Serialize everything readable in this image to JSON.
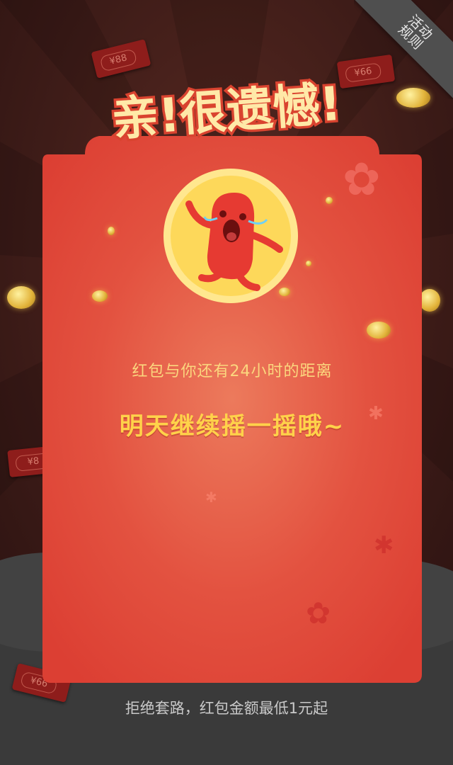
{
  "corner": {
    "rules_label": "活动规则"
  },
  "headline": {
    "text": "亲!很遗憾!"
  },
  "envelopes": [
    {
      "amount": "¥88"
    },
    {
      "amount": "¥66"
    },
    {
      "amount": "¥8"
    },
    {
      "amount": "¥66"
    }
  ],
  "card": {
    "subtitle": "红包与你还有24小时的距离",
    "message": "明天继续摇一摇哦~"
  },
  "footer": {
    "note": "拒绝套路，红包金额最低1元起"
  },
  "colors": {
    "card_red": "#e2473a",
    "headline_fill": "#ffe9a8",
    "headline_stroke": "#d9432f",
    "avatar_yellow": "#fdd85a",
    "message_yellow": "#ffd24a"
  },
  "icons": {
    "avatar": "crying-bean-mascot-icon",
    "coin": "gold-coin-icon",
    "flower": "blossom-icon"
  }
}
